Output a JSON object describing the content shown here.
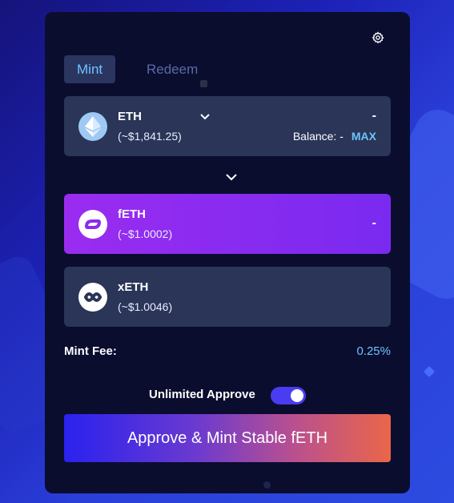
{
  "tabs": {
    "mint": "Mint",
    "redeem": "Redeem"
  },
  "input_token": {
    "name": "ETH",
    "price": "(~$1,841.25)",
    "amount": "-",
    "balance_label": "Balance: -",
    "max_label": "MAX"
  },
  "output_tokens": [
    {
      "name": "fETH",
      "price": "(~$1.0002)",
      "amount": "-"
    },
    {
      "name": "xETH",
      "price": "(~$1.0046)"
    }
  ],
  "fee": {
    "label": "Mint Fee:",
    "value": "0.25%"
  },
  "approve": {
    "label": "Unlimited Approve",
    "enabled": true
  },
  "cta_label": "Approve & Mint Stable fETH",
  "colors": {
    "accent": "#6ec3ff",
    "panel": "#0a0d2e",
    "card": "#2a3558",
    "feth_card": "#8a2cf0"
  },
  "icons": {
    "settings": "gear-icon",
    "eth": "ethereum-icon",
    "feth": "feth-icon",
    "xeth": "xeth-icon",
    "caret": "chevron-down-icon",
    "swap": "arrow-down-icon"
  }
}
